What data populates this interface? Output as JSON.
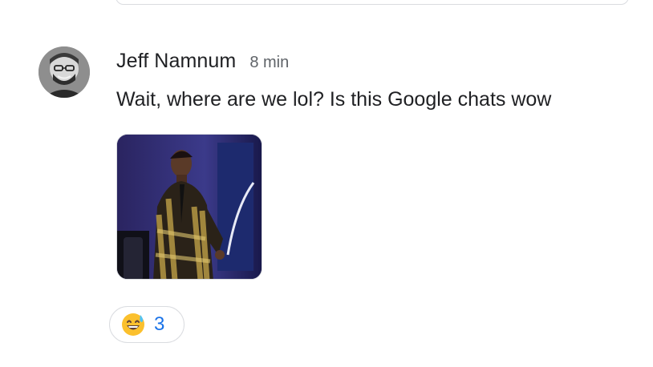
{
  "message": {
    "sender_name": "Jeff Namnum",
    "timestamp": "8 min",
    "text": "Wait, where are we lol? Is this Google chats wow",
    "attachment_icon": "animated-gif-image",
    "reaction": {
      "emoji_icon": "grinning-face-with-sweat-emoji",
      "count": "3"
    }
  },
  "colors": {
    "text_primary": "#202124",
    "text_secondary": "#5f6368",
    "reaction_count": "#1a73e8",
    "border": "#dadce0"
  }
}
